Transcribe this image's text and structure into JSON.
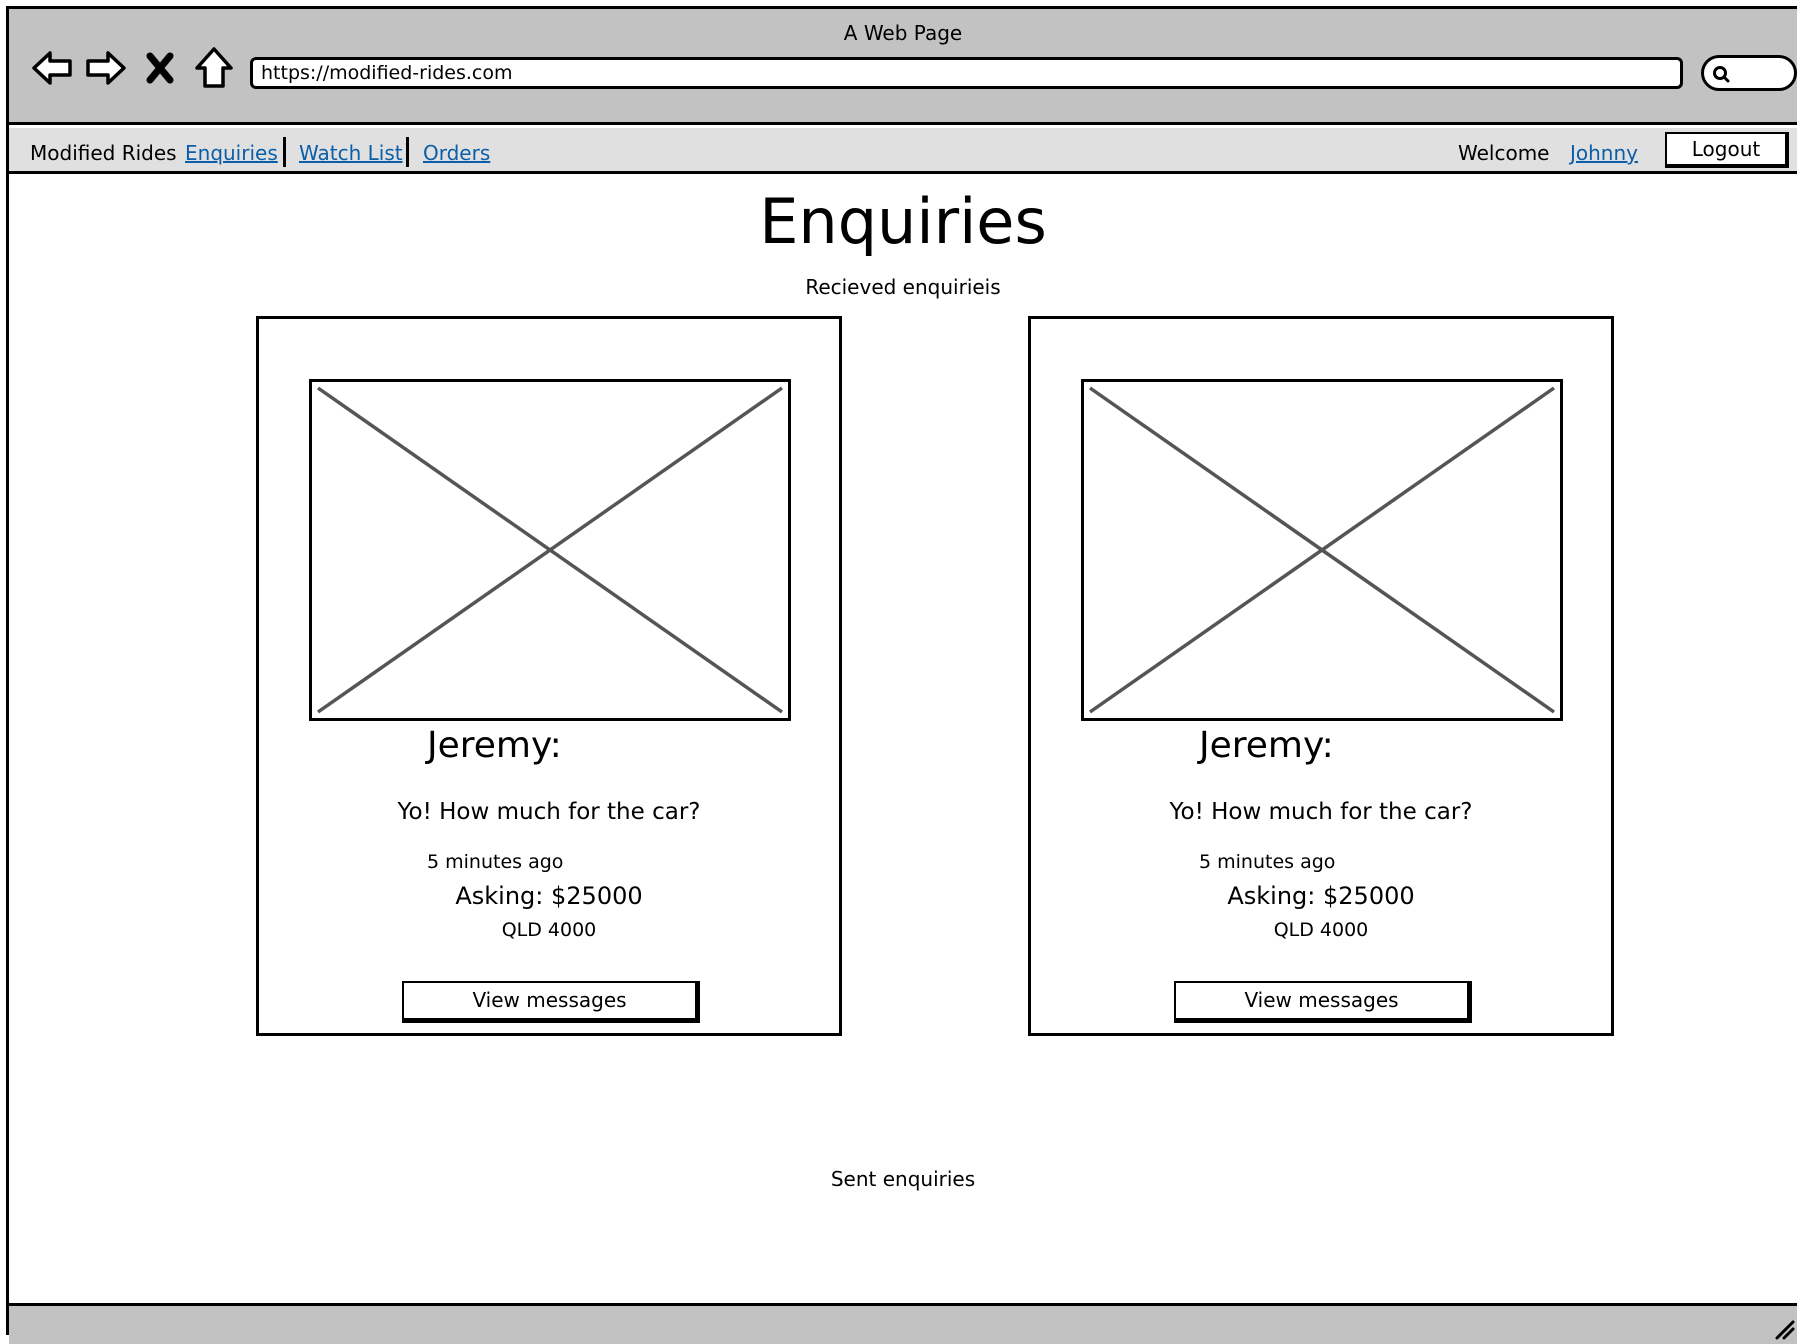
{
  "window": {
    "title": "A Web Page",
    "url": "https://modified-rides.com"
  },
  "navbar": {
    "brand": "Modified Rides",
    "links": [
      "Enquiries",
      "Watch List",
      "Orders"
    ],
    "welcome": "Welcome",
    "user": "Johnny",
    "logout": "Logout"
  },
  "page": {
    "title": "Enquiries",
    "received_label": "Recieved enquirieis",
    "sent_label": "Sent enquiries"
  },
  "cards": [
    {
      "sender": "Jeremy:",
      "message": "Yo! How much for the car?",
      "time": "5 minutes ago",
      "asking": "Asking: $25000",
      "location": "QLD 4000",
      "button": "View messages"
    },
    {
      "sender": "Jeremy:",
      "message": "Yo! How much for the car?",
      "time": "5 minutes ago",
      "asking": "Asking: $25000",
      "location": "QLD 4000",
      "button": "View messages"
    }
  ]
}
